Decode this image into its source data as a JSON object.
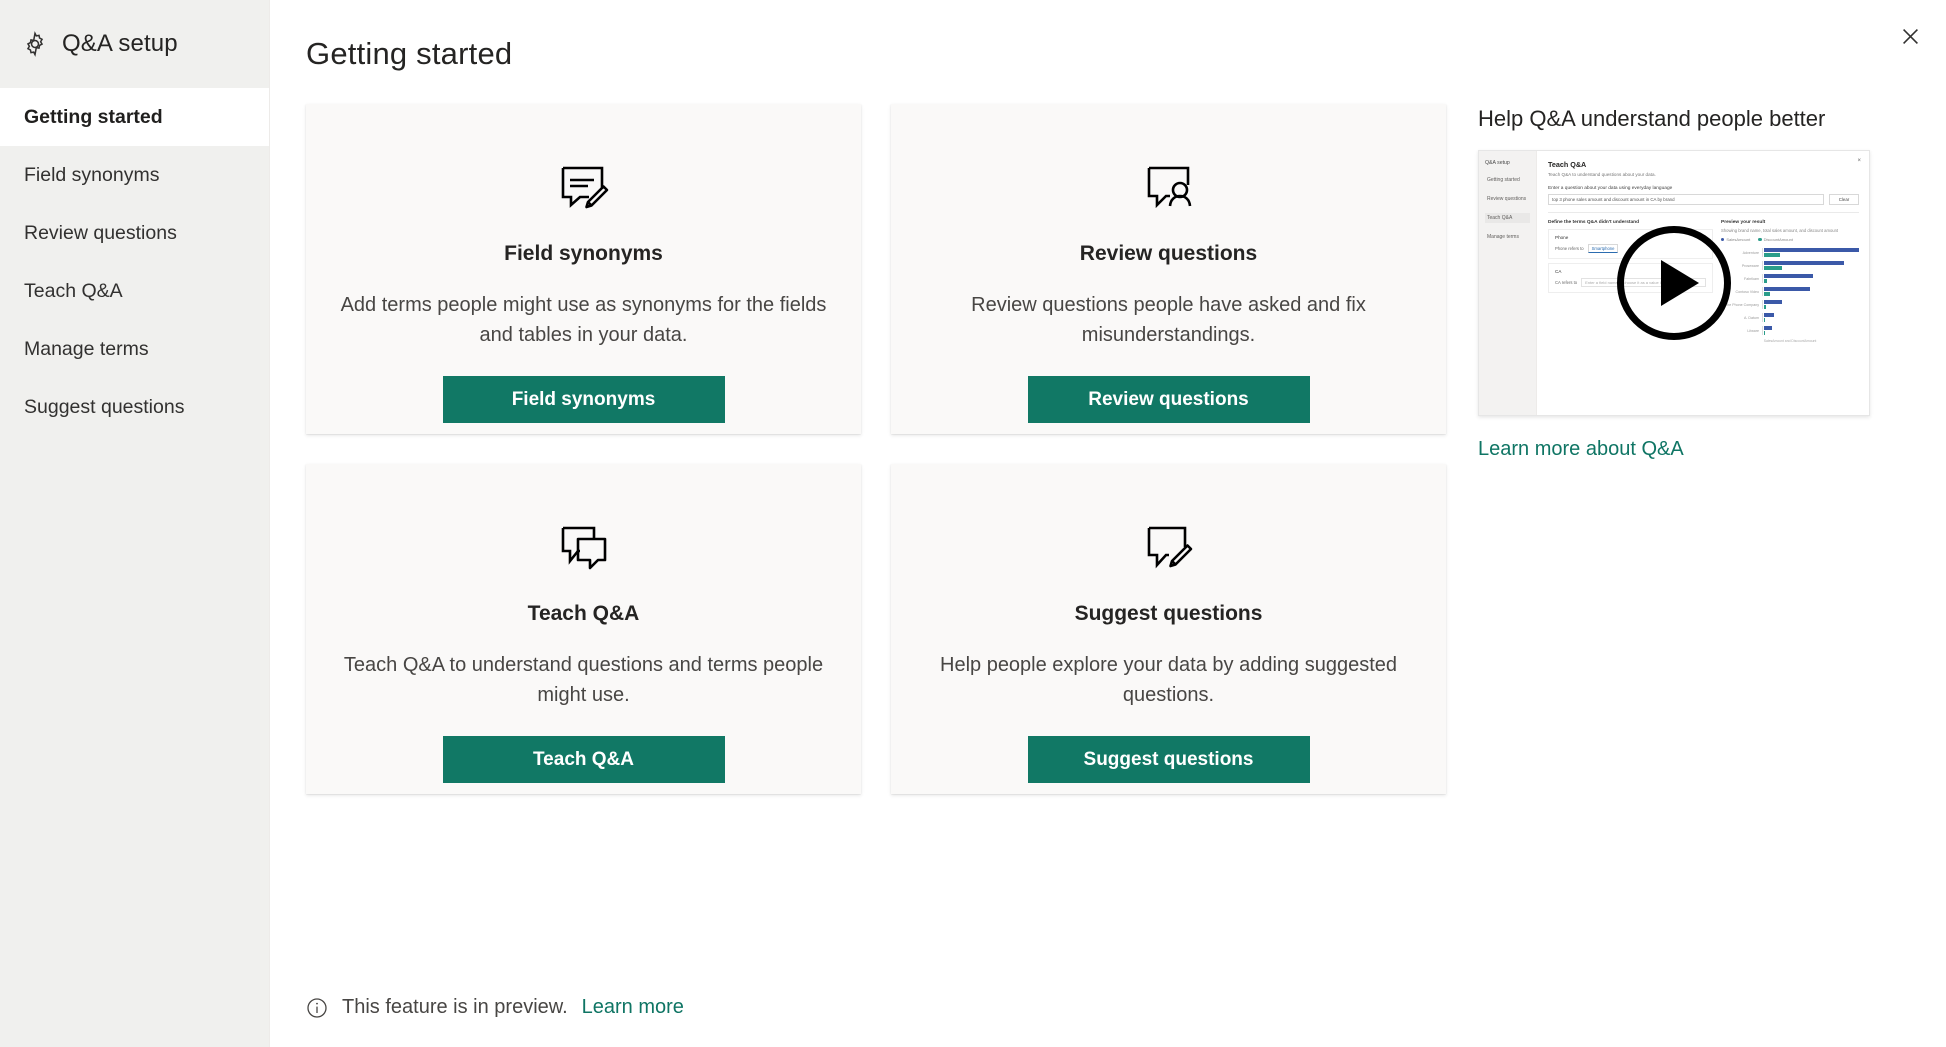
{
  "sidebar": {
    "brand": {
      "icon": "gear-icon",
      "label": "Q&A setup"
    },
    "items": [
      {
        "label": "Getting started",
        "selected": true
      },
      {
        "label": "Field synonyms",
        "selected": false
      },
      {
        "label": "Review questions",
        "selected": false
      },
      {
        "label": "Teach Q&A",
        "selected": false
      },
      {
        "label": "Manage terms",
        "selected": false
      },
      {
        "label": "Suggest questions",
        "selected": false
      }
    ]
  },
  "header": {
    "title": "Getting started",
    "close_icon": "close-icon"
  },
  "cards": [
    {
      "icon": "field-synonyms-icon",
      "title": "Field synonyms",
      "description": "Add terms people might use as synonyms for the fields and tables in your data.",
      "button_label": "Field synonyms"
    },
    {
      "icon": "review-questions-icon",
      "title": "Review questions",
      "description": "Review questions people have asked and fix misunderstandings.",
      "button_label": "Review questions"
    },
    {
      "icon": "teach-qna-icon",
      "title": "Teach Q&A",
      "description": "Teach Q&A to understand questions and terms people might use.",
      "button_label": "Teach Q&A"
    },
    {
      "icon": "suggest-questions-icon",
      "title": "Suggest questions",
      "description": "Help people explore your data by adding suggested questions.",
      "button_label": "Suggest questions"
    }
  ],
  "help": {
    "title": "Help Q&A understand people better",
    "video": {
      "play_icon": "play-icon",
      "thumbnail": {
        "sidebar_brand": "Q&A setup",
        "sidebar_items": [
          "Getting started",
          "Review questions",
          "Teach Q&A",
          "Manage terms"
        ],
        "selected_item": "Teach Q&A",
        "heading": "Teach Q&A",
        "subheading": "Teach Q&A to understand questions about your data.",
        "prompt_label": "Enter a question about your data using everyday language",
        "query_text": "top 3 phone sales amount and discount amount in CA by brand",
        "clear_button": "Clear",
        "define_label": "Define the terms Q&A didn't understand",
        "term_1_name": "Phone",
        "term_1_label": "Phone refers to",
        "term_1_value": "Smartphone",
        "term_2_name": "CA",
        "term_2_label": "CA refers to",
        "term_2_placeholder": "Enter a field name or choose it as a value in your data",
        "result_title": "Preview your result",
        "result_sub": "Showing brand name, total sales amount, and discount amount",
        "legend": [
          "SalesAmount",
          "DiscountAmount"
        ],
        "chart": {
          "type": "bar",
          "orientation": "horizontal",
          "categories": [
            "Adventure",
            "Proseware",
            "Fabrikam",
            "Contoso Video",
            "The Phone Company",
            "A. Datum",
            "Litware"
          ],
          "series": [
            {
              "name": "SalesAmount",
              "color": "#3b59a8",
              "values": [
                100,
                84,
                52,
                48,
                19,
                11,
                8
              ]
            },
            {
              "name": "DiscountAmount",
              "color": "#2a9d8a",
              "values": [
                17,
                19,
                3,
                6,
                2,
                1,
                1
              ]
            }
          ],
          "xlabel": "SalesAmount and DiscountAmount"
        }
      }
    },
    "learn_more_link": "Learn more about Q&A"
  },
  "footer": {
    "icon": "info-icon",
    "text": "This feature is in preview.",
    "link": "Learn more"
  },
  "colors": {
    "accent_green": "#117865",
    "link_green": "#0f7564",
    "sidebar_bg": "#f0f0ee",
    "card_bg": "#faf9f8",
    "chart_blue": "#3b59a8",
    "chart_teal": "#2a9d8a"
  }
}
